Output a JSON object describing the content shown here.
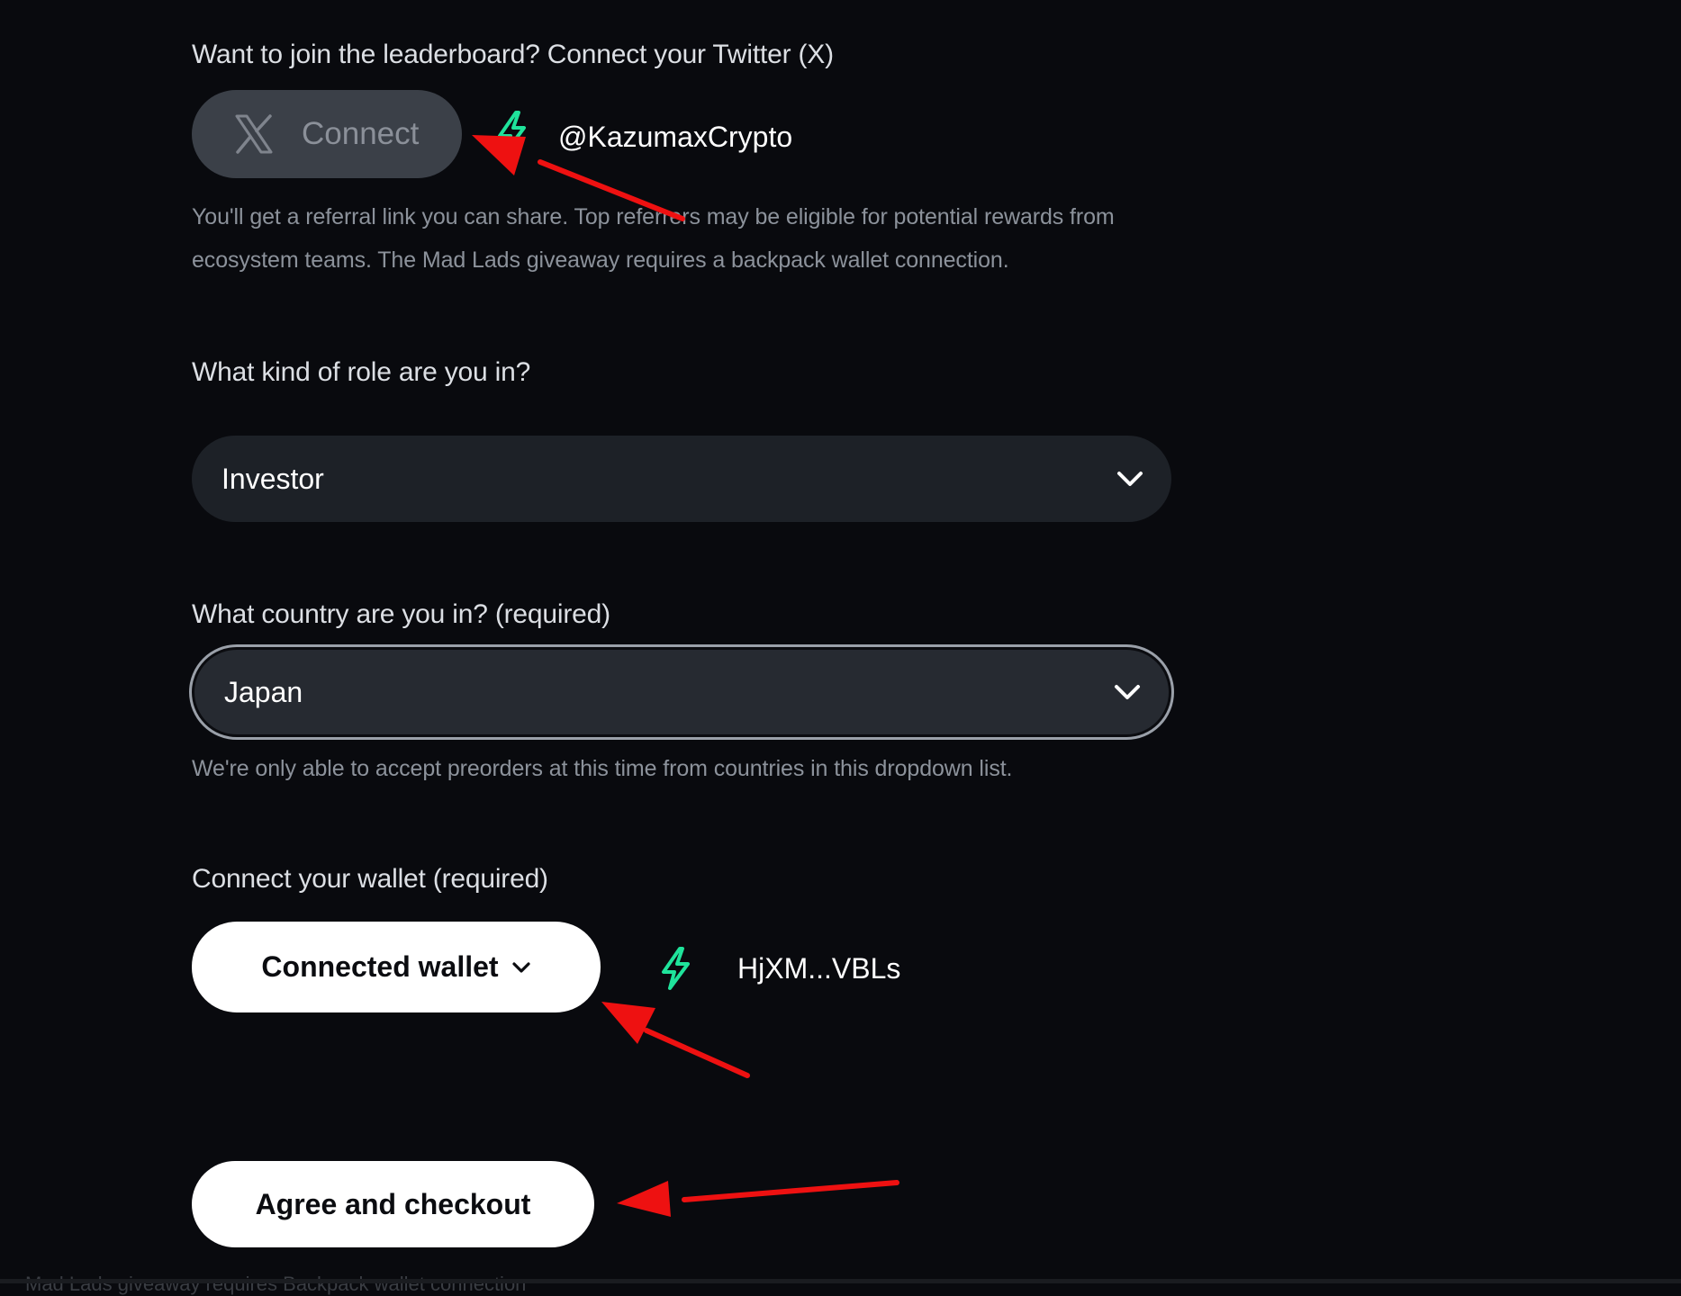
{
  "twitter": {
    "label": "Want to join the leaderboard? Connect your Twitter (X)",
    "connect_button": "Connect",
    "handle": "@KazumaxCrypto",
    "help": "You'll get a referral link you can share. Top referrers may be eligible for potential rewards from ecosystem teams. The Mad Lads giveaway requires a backpack wallet connection."
  },
  "role": {
    "label": "What kind of role are you in?",
    "value": "Investor"
  },
  "country": {
    "label": "What country are you in? (required)",
    "value": "Japan",
    "help": "We're only able to accept preorders at this time from countries in this dropdown list."
  },
  "wallet": {
    "label": "Connect your wallet (required)",
    "button": "Connected wallet",
    "address": "HjXM...VBLs"
  },
  "checkout": {
    "button": "Agree and checkout"
  },
  "footer": {
    "faint_text": "Mad Lads giveaway requires Backpack wallet connection"
  },
  "colors": {
    "background": "#090a0e",
    "connected_accent": "#1fe39b",
    "annotation_arrow": "#ee1111"
  },
  "icons": {
    "x_logo": "x-logo-icon",
    "connected": "lightning-bolt-icon",
    "dropdown": "chevron-down-icon"
  }
}
